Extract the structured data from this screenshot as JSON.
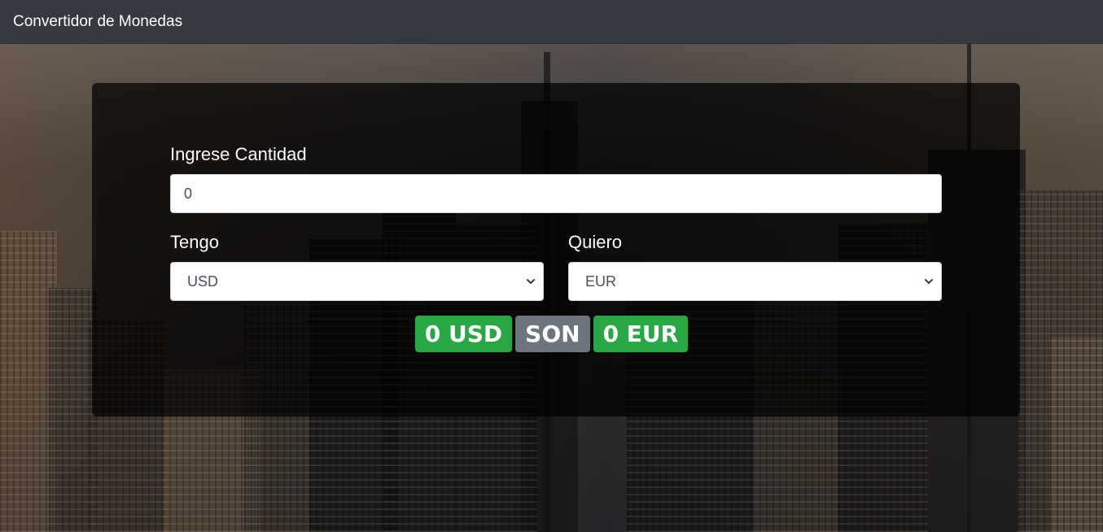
{
  "navbar": {
    "brand": "Convertidor de Monedas"
  },
  "form": {
    "amount_label": "Ingrese Cantidad",
    "amount_value": "0",
    "from_label": "Tengo",
    "from_value": "USD",
    "to_label": "Quiero",
    "to_value": "EUR"
  },
  "result": {
    "from_amount": "0 USD",
    "connector": "SON",
    "to_amount": "0 EUR"
  },
  "colors": {
    "navbar": "#343a40",
    "success": "#28a745",
    "secondary": "#6c757d"
  },
  "icons": {
    "select_arrow": "chevron-down-icon"
  }
}
